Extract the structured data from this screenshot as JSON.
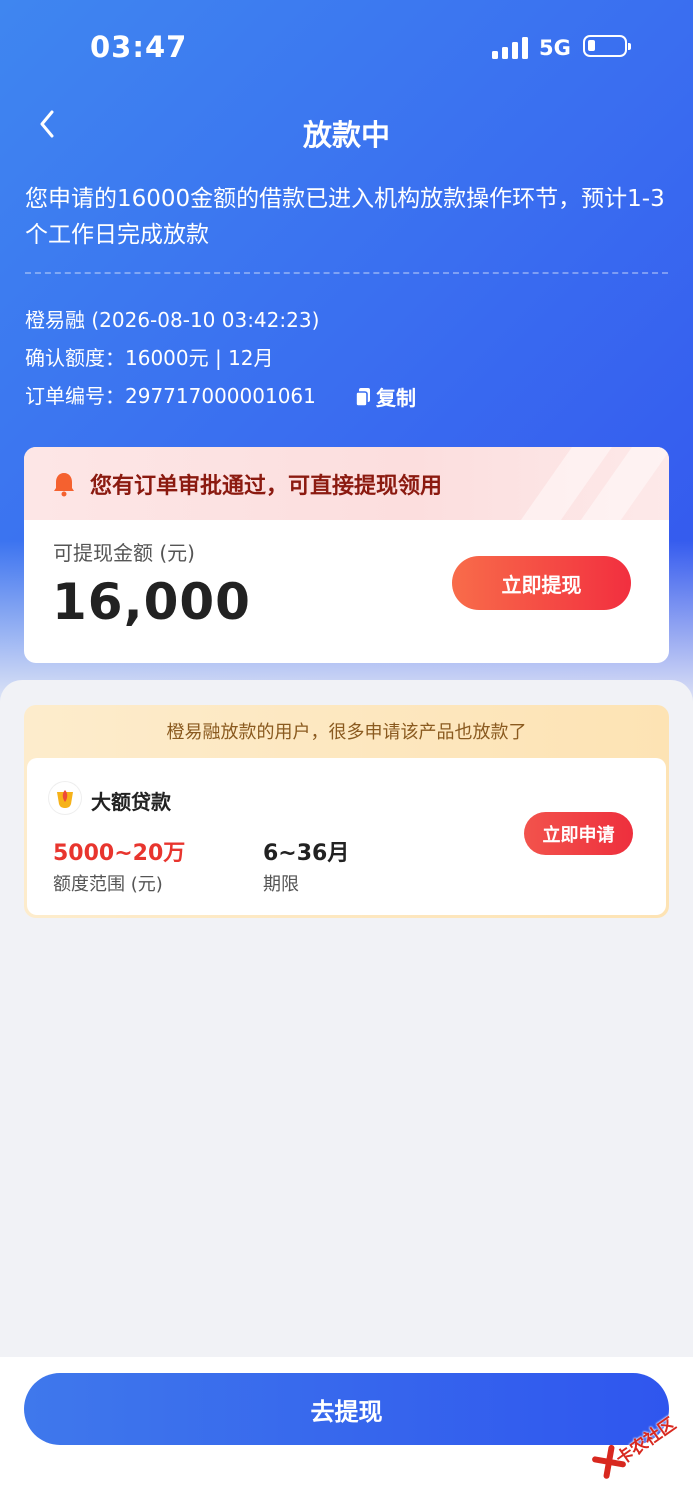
{
  "status_bar": {
    "time": "03:47",
    "network": "5G",
    "battery_percent": 15
  },
  "header": {
    "title": "放款中"
  },
  "message": "您申请的16000金额的借款已进入机构放款操作环节，预计1-3个工作日完成放款",
  "order_info": {
    "lender_line": "橙易融 (2026-08-10 03:42:23)",
    "confirm_label": "确认额度：",
    "confirm_value": "16000元 | 12月",
    "order_label": "订单编号：",
    "order_value": "297717000001061",
    "copy_label": "复制"
  },
  "withdraw_card": {
    "notice": "您有订单审批通过，可直接提现领用",
    "amount_label": "可提现金额 (元)",
    "amount": "16,000",
    "button_label": "立即提现"
  },
  "recommendation": {
    "header": "橙易融放款的用户，很多申请该产品也放款了",
    "product_name": "大额贷款",
    "range_value": "5000~20万",
    "range_label": "额度范围 (元)",
    "term_value": "6~36月",
    "term_label": "期限",
    "apply_label": "立即申请"
  },
  "bottom_button": {
    "label": "去提现"
  },
  "watermark": {
    "text": "卡农社区"
  },
  "colors": {
    "primary_blue": "#3a6ef0",
    "accent_red": "#f22f3f",
    "range_red": "#e8352e",
    "notice_text": "#8b1a10"
  }
}
